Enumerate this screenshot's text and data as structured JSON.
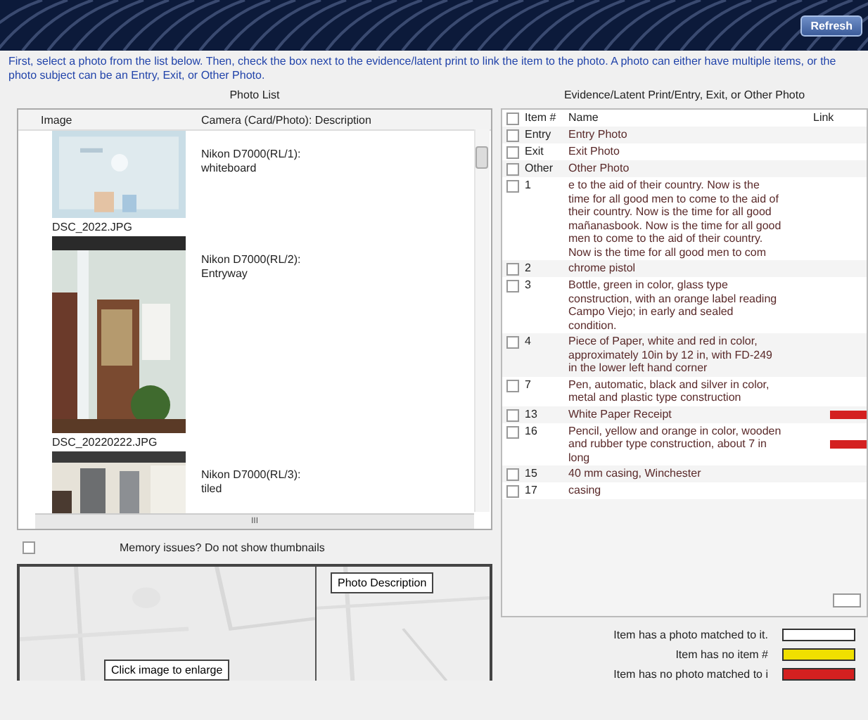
{
  "header": {
    "button": "Refresh"
  },
  "instructions": "First, select a photo from the list below. Then, check the box next to the evidence/latent print to link the item to the photo. A photo can either have multiple items, or the photo subject can be an Entry, Exit, or Other Photo.",
  "photo_list": {
    "title": "Photo List",
    "columns": [
      "Image",
      "Camera (Card/Photo): Description"
    ],
    "rows": [
      {
        "filename": "DSC_2022.JPG",
        "camera": "Nikon D7000(RL/1):",
        "description": "whiteboard",
        "kind": "picture"
      },
      {
        "filename": "DSC_20220222.JPG",
        "camera": "Nikon D7000(RL/2):",
        "description": "Entryway",
        "kind": "picture"
      },
      {
        "camera": "Nikon D7000(RL/3):",
        "description": "tiled",
        "kind": "picture"
      }
    ],
    "scroll_label": "III"
  },
  "memory_option": {
    "label": "Memory issues? Do not show thumbnails",
    "checked": false
  },
  "preview": {
    "description_button": "Photo Description",
    "enlarge_button": "Click image to enlarge",
    "kind": "picture"
  },
  "evidence": {
    "title": "Evidence/Latent Print/Entry, Exit, or Other Photo",
    "columns": [
      "Item #",
      "Name",
      "Link"
    ],
    "header_checked": false,
    "rows": [
      {
        "item": "Entry",
        "name": "Entry Photo",
        "checked": false
      },
      {
        "item": "Exit",
        "name": "Exit Photo",
        "checked": false
      },
      {
        "item": "Other",
        "name": "Other Photo",
        "checked": false
      },
      {
        "item": "1",
        "name": "e to the aid of their country.  Now is the time for all good men to come to the aid of their country.  Now is the time for all good mañanasbook.  Now is the time for all good men to come to the aid of their country. Now is the time for all good men to com",
        "checked": false
      },
      {
        "item": "2",
        "name": "chrome pistol",
        "checked": false
      },
      {
        "item": "3",
        "name": "Bottle, green in color, glass type construction, with an orange label reading Campo Viejo; in early and sealed condition.",
        "checked": false
      },
      {
        "item": "4",
        "name": "Piece of Paper, white and red in color, approximately 10in by 12 in, with FD-249 in the lower left hand corner",
        "checked": false
      },
      {
        "item": "7",
        "name": "Pen, automatic, black and silver in color, metal and plastic type construction",
        "checked": false
      },
      {
        "item": "13",
        "name": "White Paper Receipt",
        "checked": false,
        "color": "#d42020"
      },
      {
        "item": "16",
        "name": "Pencil, yellow and orange in color, wooden and rubber type construction, about 7 in long",
        "checked": false,
        "color": "#d42020"
      },
      {
        "item": "15",
        "name": "40 mm casing, Winchester",
        "checked": false
      },
      {
        "item": "17",
        "name": "casing",
        "checked": false
      }
    ]
  },
  "legend": [
    {
      "label": "Item has a photo matched to it.",
      "color": "#ffffff"
    },
    {
      "label": "Item has no item #",
      "color": "#f0e000"
    },
    {
      "label": "Item has no photo matched to i",
      "color": "#d42020"
    }
  ]
}
